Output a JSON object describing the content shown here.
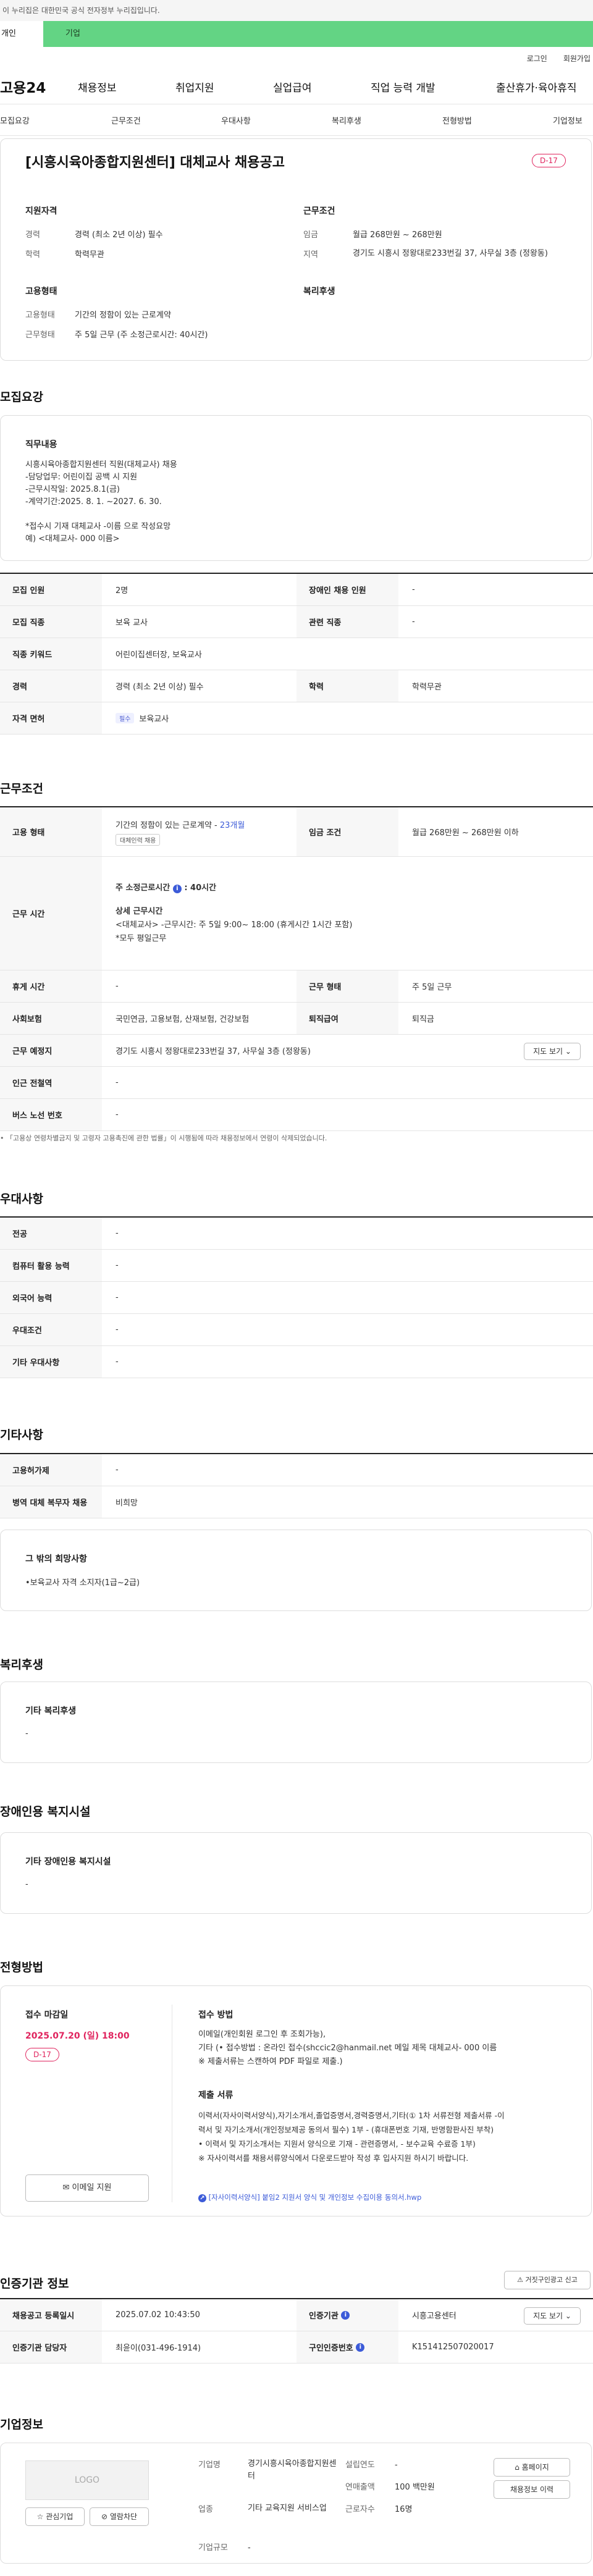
{
  "gov_banner": {
    "text": "이 누리집은 대한민국 공식 전자정부 누리집입니다."
  },
  "top_tabs": {
    "personal": "개인",
    "company": "기업"
  },
  "utility": {
    "login": "로그인",
    "signup": "회원가입"
  },
  "gnb": {
    "logo": "고용24",
    "items": [
      "채용정보",
      "취업지원",
      "실업급여",
      "직업 능력 개발",
      "출산휴가·육아휴직"
    ]
  },
  "subnav": [
    "모집요강",
    "근무조건",
    "우대사항",
    "복리후생",
    "전형방법",
    "기업정보"
  ],
  "job": {
    "title": "[시흥시육아종합지원센터] 대체교사 채용공고",
    "dday": "D-17",
    "qual_heading": "지원자격",
    "cond_heading": "근무조건",
    "emp_heading": "고용형태",
    "welfare_heading": "복리후생",
    "career_label": "경력",
    "career_value": "경력 (최소 2년 이상) 필수",
    "edu_label": "학력",
    "edu_value": "학력무관",
    "wage_label": "임금",
    "wage_value": "월급 268만원 ~ 268만원",
    "region_label": "지역",
    "region_value": "경기도 시흥시 정왕대로233번길 37, 사무실 3층 (정왕동)",
    "emp_label": "고용형태",
    "emp_value": "기간의 정함이 있는 근로계약",
    "work_label": "근무형태",
    "work_value": "주 5일 근무 (주 소정근로시간: 40시간)"
  },
  "recruit": {
    "heading": "모집요강",
    "duty_title": "직무내용",
    "duty_lines": [
      "시흥시육아종합지원센터 직원(대체교사) 채용",
      "-담당업무: 어린이집 공백 시 지원",
      "-근무시작일: 2025.8.1(금)",
      "-계약기간:2025. 8. 1. ~2027. 6. 30.",
      "",
      "*접수시 기재 대체교사 -이름 으로 작성요망",
      "예) <대체교사- 000 이름>"
    ],
    "rows": [
      [
        "모집 인원",
        "2명",
        "장애인 채용 인원",
        "-"
      ],
      [
        "모집 직종",
        "보육 교사",
        "관련 직종",
        "-"
      ],
      [
        "직종 키워드",
        "어린이집센터장, 보육교사"
      ],
      [
        "경력",
        "경력 (최소 2년 이상) 필수",
        "학력",
        "학력무관"
      ]
    ],
    "license_label": "자격 면허",
    "license_badge": "필수",
    "license_value": "보육교사"
  },
  "conditions": {
    "heading": "근무조건",
    "emp_label": "고용 형태",
    "emp_value": "기간의 정함이 있는 근로계약 -",
    "emp_months": "23개월",
    "emp_badge": "대체인력 채용",
    "wage_label": "임금 조건",
    "wage_value": "월급 268만원 ~ 268만원 이하",
    "hours_label": "근무 시간",
    "hours_total": "주 소정근로시간",
    "hours_total_value": ": 40시간",
    "hours_detail_title": "상세 근무시간",
    "hours_detail_1": "<대체교사> -근무시간: 주 5일 9:00~ 18:00 (휴게시간 1시간 포함)",
    "hours_detail_2": "*모두 평일근무",
    "workdays_label": "근무 형태",
    "workdays_value": "주 5일 근무",
    "break_label": "휴게 시간",
    "break_value": "-",
    "insurance_label": "사회보험",
    "insurance_value": "국민연금, 고용보험, 산재보험, 건강보험",
    "retire_label": "퇴직급여",
    "retire_value": "퇴직금",
    "place_label": "근무 예정지",
    "place_value": "경기도 시흥시 정왕대로233번길 37, 사무실 3층 (정왕동)",
    "map_btn": "지도 보기",
    "subway_label": "인근 전철역",
    "subway_value": "-",
    "bus_label": "버스 노선 번호",
    "bus_value": "-",
    "notice": "「고용상 연령차별금지 및 고령자 고용촉진에 관한 법률」이 시행됨에 따라 채용정보에서 연령이 삭제되었습니다."
  },
  "preference": {
    "heading": "우대사항",
    "rows": [
      [
        "전공",
        "-"
      ],
      [
        "컴퓨터 활용 능력",
        "-"
      ],
      [
        "외국어 능력",
        "-"
      ],
      [
        "우대조건",
        "-"
      ],
      [
        "기타 우대사항",
        "-"
      ]
    ]
  },
  "others": {
    "heading": "기타사항",
    "rows": [
      [
        "고용허가제",
        "-"
      ],
      [
        "병역 대체 복무자 채용",
        "비희망"
      ]
    ],
    "extra_title": "그 밖의 희망사항",
    "extra_value": "•보육교사 자격 소지자(1급~2급)"
  },
  "welfare": {
    "heading": "복리후생",
    "box_title": "기타 복리후생",
    "box_value": "-"
  },
  "disability": {
    "heading": "장애인용 복지시설",
    "box_title": "기타 장애인용 복지시설",
    "box_value": "-"
  },
  "process": {
    "heading": "전형방법",
    "deadline_title": "접수 마감일",
    "deadline": "2025.07.20 (일) 18:00",
    "dday": "D-17",
    "email_btn": "이메일 지원",
    "method_title": "접수 방법",
    "method_lines": [
      "이메일(개인회원 로그인 후 조회가능),",
      "기타 (• 접수방법 : 온라인 접수(shccic2@hanmail.net    메일 제목 대체교사- 000 이름",
      "※ 제출서류는 스캔하여 PDF 파일로 제출.)"
    ],
    "docs_title": "제출 서류",
    "docs_lines": [
      "이력서(자사이력서양식),자기소개서,졸업증명서,경력증명서,기타(① 1차 서류전형 제출서류 -이",
      "력서 및 자기소개서(개인정보제공 동의서 필수) 1부 - (휴대폰번호 기재, 반명함판사진 부착)",
      "• 이력서 및 자기소개서는 지원서 양식으로 기재 - 관련증명서, - 보수교육 수료증 1부)",
      "※ 자사이력서를 채용서류양식에서 다운로드받아 작성 후 입사지원 하시기 바랍니다."
    ],
    "file_link": "[자사이력서양식] 붙임2 지원서 양식 및 개인정보 수집이용 동의서.hwp"
  },
  "cert": {
    "heading": "인증기관 정보",
    "report_btn": "거짓구인광고 신고",
    "reg_label": "채용공고 등록일시",
    "reg_value": "2025.07.02 10:43:50",
    "org_label": "인증기관",
    "org_value": "시흥고용센터",
    "map_btn": "지도 보기",
    "manager_label": "인증기관 담당자",
    "manager_value": "최윤이(031-496-1914)",
    "certno_label": "구인인증번호",
    "certno_value": "K151412507020017"
  },
  "company": {
    "heading": "기업정보",
    "logo": "LOGO",
    "interest_btn": "관심기업",
    "hide_btn": "열람차단",
    "name_label": "기업명",
    "name_value": "경기시흥시육아종합지원센터",
    "industry_label": "업종",
    "industry_value": "기타 교육지원 서비스업",
    "size_label": "기업규모",
    "size_value": "-",
    "founded_label": "설립연도",
    "founded_value": "-",
    "revenue_label": "연매출액",
    "revenue_value": "100 백만원",
    "staff_label": "근로자수",
    "staff_value": "16명",
    "homepage_btn": "홈페이지",
    "jobs_btn": "채용정보 이력"
  },
  "colors": {
    "green": "#63d484",
    "red": "#e0245e",
    "blue": "#3c5bd8"
  }
}
